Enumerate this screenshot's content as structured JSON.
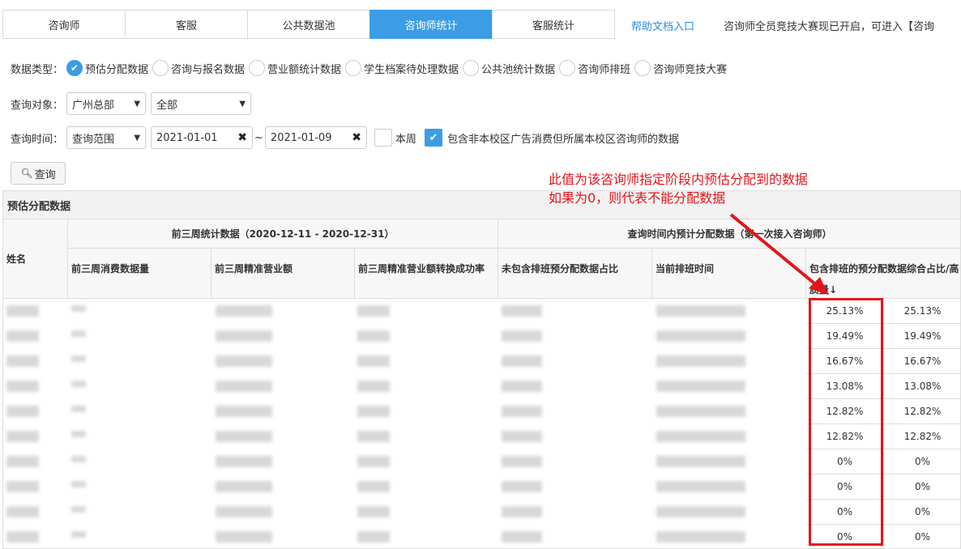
{
  "tabs": [
    "咨询师",
    "客服",
    "公共数据池",
    "咨询师统计",
    "客服统计"
  ],
  "active_tab": 3,
  "help_link": "帮助文档入口",
  "notice": "咨询师全员竞技大赛现已开启，可进入【咨询",
  "filters": {
    "data_type_label": "数据类型：",
    "data_types": [
      "预估分配数据",
      "咨询与报名数据",
      "营业额统计数据",
      "学生档案待处理数据",
      "公共池统计数据",
      "咨询师排班",
      "咨询师竞技大赛"
    ],
    "selected_type": 0,
    "target_label": "查询对象：",
    "target_org": "广州总部",
    "target_scope": "全部",
    "time_label": "查询时间：",
    "time_mode": "查询范围",
    "date_from": "2021-01-01",
    "date_to": "2021-01-09",
    "tilde": "~",
    "this_week_label": "本周",
    "this_week_checked": false,
    "include_label": "包含非本校区广告消费但所属本校区咨询师的数据",
    "include_checked": true,
    "query_button": "查询"
  },
  "annotation": {
    "line1": "此值为该咨询师指定阶段内预估分配到的数据",
    "line2": "如果为0，则代表不能分配数据"
  },
  "panel_title": "预估分配数据",
  "table": {
    "name_header": "姓名",
    "group1": "前三周统计数据（2020-12-11 - 2020-12-31）",
    "group2": "查询时间内预计分配数据（第一次接入咨询师）",
    "columns": [
      "前三周消费数据量",
      "前三周精准营业额",
      "前三周精准营业额转换成功率",
      "未包含排班预分配数据占比",
      "当前排班时间",
      "包含排班的预分配数据综合占比/高质量↓"
    ],
    "ratio_a": [
      "25.13%",
      "19.49%",
      "16.67%",
      "13.08%",
      "12.82%",
      "12.82%",
      "0%",
      "0%",
      "0%",
      "0%"
    ],
    "ratio_b": [
      "25.13%",
      "19.49%",
      "16.67%",
      "13.08%",
      "12.82%",
      "12.82%",
      "0%",
      "0%",
      "0%",
      "0%"
    ]
  },
  "colors": {
    "accent": "#3a9de6",
    "annotation": "#e4141b"
  }
}
